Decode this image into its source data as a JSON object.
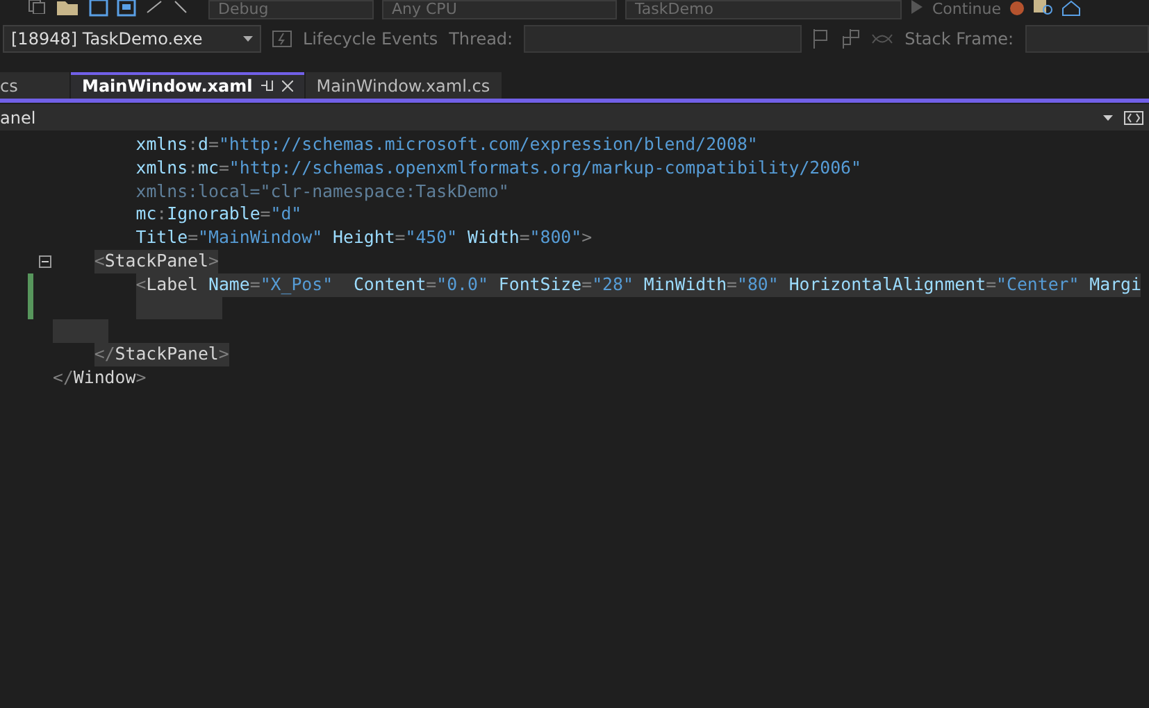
{
  "toolbar": {
    "configuration": "Debug",
    "platform": "Any CPU",
    "startup_project": "TaskDemo",
    "continue_button": "Continue"
  },
  "debug_bar": {
    "process": "[18948] TaskDemo.exe",
    "lifecycle_events": "Lifecycle Events",
    "thread_label": "Thread:",
    "stack_frame_label": "Stack Frame:"
  },
  "tabs": [
    {
      "label": "cs",
      "selected": false
    },
    {
      "label": "MainWindow.xaml",
      "selected": true
    },
    {
      "label": "MainWindow.xaml.cs",
      "selected": false
    }
  ],
  "navigation_bar": {
    "element": "anel"
  },
  "code_lines": [
    {
      "kind": "attribute",
      "selected": false,
      "changed": false,
      "segments": [
        {
          "kind": "attr",
          "text": "xmlns"
        },
        {
          "kind": "punct",
          "text": ":"
        },
        {
          "kind": "attr",
          "text": "d"
        },
        {
          "kind": "punct",
          "text": "="
        },
        {
          "kind": "string",
          "text": "\"http://schemas.microsoft.com/expression/blend/2008\""
        }
      ]
    },
    {
      "kind": "attribute",
      "selected": false,
      "changed": false,
      "segments": [
        {
          "kind": "attr",
          "text": "xmlns"
        },
        {
          "kind": "punct",
          "text": ":"
        },
        {
          "kind": "attr",
          "text": "mc"
        },
        {
          "kind": "punct",
          "text": "="
        },
        {
          "kind": "string",
          "text": "\"http://schemas.openxmlformats.org/markup-compatibility/2006\""
        }
      ]
    },
    {
      "kind": "attribute",
      "selected": false,
      "changed": false,
      "segments": [
        {
          "kind": "dim",
          "text": "xmlns:local=\"clr-namespace:TaskDemo\""
        }
      ]
    },
    {
      "kind": "attribute",
      "selected": false,
      "changed": false,
      "segments": [
        {
          "kind": "attr",
          "text": "mc"
        },
        {
          "kind": "punct",
          "text": ":"
        },
        {
          "kind": "attr",
          "text": "Ignorable"
        },
        {
          "kind": "punct",
          "text": "="
        },
        {
          "kind": "string",
          "text": "\"d\""
        }
      ]
    },
    {
      "kind": "attribute",
      "selected": false,
      "changed": false,
      "segments": [
        {
          "kind": "attr",
          "text": "Title"
        },
        {
          "kind": "punct",
          "text": "="
        },
        {
          "kind": "string",
          "text": "\"MainWindow\""
        },
        {
          "kind": "attr",
          "text": " Height"
        },
        {
          "kind": "punct",
          "text": "="
        },
        {
          "kind": "string",
          "text": "\"450\""
        },
        {
          "kind": "attr",
          "text": " Width"
        },
        {
          "kind": "punct",
          "text": "="
        },
        {
          "kind": "string",
          "text": "\"800\""
        },
        {
          "kind": "punct",
          "text": ">"
        }
      ]
    },
    {
      "kind": "child",
      "selected": true,
      "changed": false,
      "segments": [
        {
          "kind": "punct",
          "text": "<"
        },
        {
          "kind": "element",
          "text": "StackPanel"
        },
        {
          "kind": "punct",
          "text": ">"
        }
      ]
    },
    {
      "kind": "grandchild",
      "selected": true,
      "changed": true,
      "segments": [
        {
          "kind": "punct",
          "text": "<"
        },
        {
          "kind": "element",
          "text": "Label"
        },
        {
          "kind": "attr",
          "text": " Name"
        },
        {
          "kind": "punct",
          "text": "="
        },
        {
          "kind": "string",
          "text": "\"X_Pos\""
        },
        {
          "kind": "attr",
          "text": "  Content"
        },
        {
          "kind": "punct",
          "text": "="
        },
        {
          "kind": "string",
          "text": "\"0.0\""
        },
        {
          "kind": "attr",
          "text": " FontSize"
        },
        {
          "kind": "punct",
          "text": "="
        },
        {
          "kind": "string",
          "text": "\"28\""
        },
        {
          "kind": "attr",
          "text": " MinWidth"
        },
        {
          "kind": "punct",
          "text": "="
        },
        {
          "kind": "string",
          "text": "\"80\""
        },
        {
          "kind": "attr",
          "text": " HorizontalAlignment"
        },
        {
          "kind": "punct",
          "text": "="
        },
        {
          "kind": "string",
          "text": "\"Center\""
        },
        {
          "kind": "attr",
          "text": " Margi"
        }
      ]
    },
    {
      "kind": "grandchild",
      "selected": true,
      "changed": true
    },
    {
      "kind": "root",
      "selected": true,
      "changed": false
    },
    {
      "kind": "child",
      "selected": true,
      "changed": false,
      "segments": [
        {
          "kind": "punct",
          "text": "</"
        },
        {
          "kind": "element",
          "text": "StackPanel"
        },
        {
          "kind": "punct",
          "text": ">"
        }
      ]
    },
    {
      "kind": "root",
      "selected": false,
      "changed": false,
      "segments": [
        {
          "kind": "punct",
          "text": "</"
        },
        {
          "kind": "element",
          "text": "Window"
        },
        {
          "kind": "punct",
          "text": ">"
        }
      ]
    }
  ]
}
